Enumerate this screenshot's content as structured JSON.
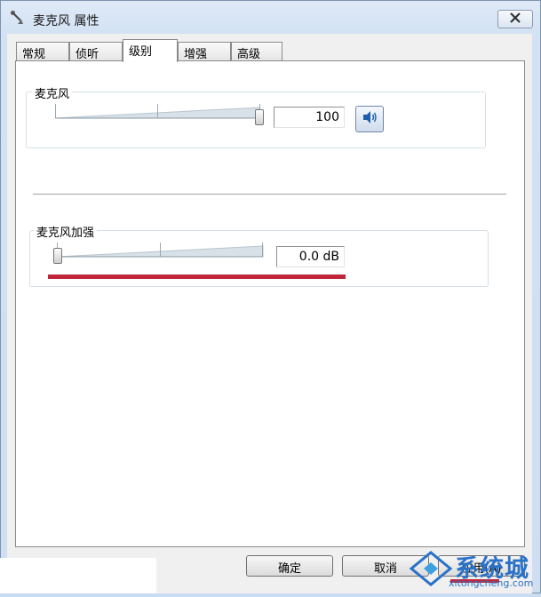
{
  "window": {
    "title": "麦克风 属性"
  },
  "tabs": [
    {
      "label": "常规"
    },
    {
      "label": "侦听"
    },
    {
      "label": "级别"
    },
    {
      "label": "增强"
    },
    {
      "label": "高级"
    }
  ],
  "active_tab": "级别",
  "microphone": {
    "label": "麦克风",
    "value": "100",
    "level_fraction": 1.0
  },
  "boost": {
    "label": "麦克风加强",
    "value": "0.0 dB",
    "level_fraction": 0.0
  },
  "buttons": {
    "ok": "确定",
    "cancel": "取消",
    "apply": "应用(A)"
  },
  "watermark": {
    "brand": "系统城",
    "url": "xitongcheng.com"
  },
  "colors": {
    "highlight_red": "#c0263c",
    "watermark_blue": "#2a72c8"
  },
  "icons": {
    "title": "microphone-icon",
    "close": "close-icon",
    "speaker": "speaker-icon",
    "watermark": "windows-logo-icon"
  }
}
